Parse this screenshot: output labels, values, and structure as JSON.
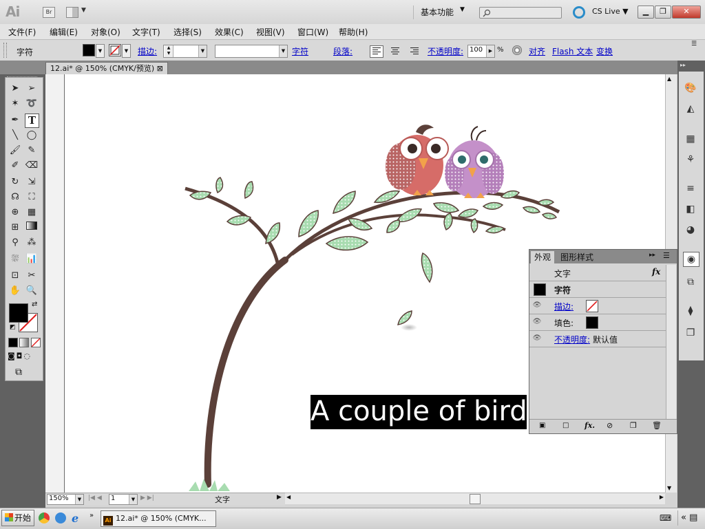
{
  "titlebar": {
    "logo": "Ai",
    "bridge": "Br",
    "workspace": "基本功能",
    "cslive": "CS Live"
  },
  "menu": [
    "文件(F)",
    "编辑(E)",
    "对象(O)",
    "文字(T)",
    "选择(S)",
    "效果(C)",
    "视图(V)",
    "窗口(W)",
    "帮助(H)"
  ],
  "control": {
    "selection_label": "字符",
    "stroke_label": "描边:",
    "char_link": "字符",
    "para_link": "段落:",
    "opacity_label": "不透明度:",
    "opacity_value": "100",
    "opacity_unit": "%",
    "align_link": "对齐",
    "flash_link": "Flash 文本",
    "transform_link": "变换"
  },
  "document": {
    "tab_title": "12.ai* @ 150% (CMYK/预览)",
    "tab_close": "⊠",
    "caption": "A couple of birds"
  },
  "status": {
    "zoom": "150%",
    "artboard": "1",
    "tool_label": "文字"
  },
  "appearance_panel": {
    "tab1": "外观",
    "tab2": "图形样式",
    "header": "文字",
    "fx": "fx",
    "char_row": "字符",
    "stroke_label": "描边:",
    "fill_label": "填色:",
    "opacity_label": "不透明度:",
    "opacity_value": "默认值"
  },
  "taskbar": {
    "start": "开始",
    "task": "12.ai* @ 150% (CMYK..."
  },
  "colors": {
    "fill": "#000000",
    "branch": "#5b4039",
    "leaf": "#a8dcb0",
    "bird1": "#d66c68",
    "bird2": "#c490c9"
  },
  "icons": [
    "selection-tool-icon",
    "direct-selection-icon",
    "magic-wand-icon",
    "lasso-icon",
    "pen-icon",
    "type-tool-icon",
    "line-icon",
    "ellipse-icon",
    "brush-icon",
    "pencil-icon",
    "blob-brush-icon",
    "eraser-icon",
    "rotate-icon",
    "scale-icon",
    "warp-icon",
    "free-transform-icon",
    "shape-builder-icon",
    "perspective-icon",
    "mesh-icon",
    "gradient-icon",
    "eyedropper-icon",
    "blend-icon",
    "symbol-sprayer-icon",
    "graph-icon",
    "artboard-icon",
    "slice-icon",
    "hand-icon",
    "zoom-icon"
  ]
}
